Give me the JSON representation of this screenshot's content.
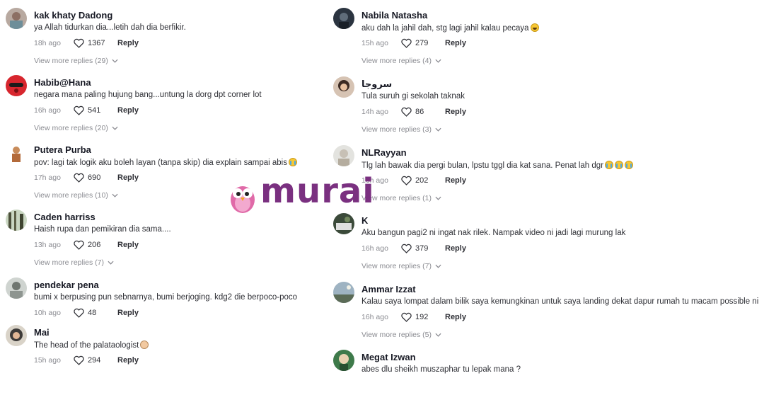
{
  "left_comments": [
    {
      "username": "kak khaty Dadong",
      "text": "ya Allah tidurkan dia...letih dah dia berfikir.",
      "emoji": "",
      "time": "18h ago",
      "likes": "1367",
      "reply": "Reply",
      "more_replies": "View more replies (29)",
      "avatar": "avatar-photo-1"
    },
    {
      "username": "Habib@Hana",
      "text": "negara mana paling hujung bang...untung la dorg dpt corner lot",
      "emoji": "",
      "time": "16h ago",
      "likes": "541",
      "reply": "Reply",
      "more_replies": "View more replies (20)",
      "avatar": "avatar-mask"
    },
    {
      "username": "Putera Purba",
      "text": "pov: lagi tak logik aku boleh layan (tanpa skip) dia explain sampai abis",
      "emoji": "cry",
      "time": "17h ago",
      "likes": "690",
      "reply": "Reply",
      "more_replies": "View more replies (10)",
      "avatar": "avatar-person"
    },
    {
      "username": "Caden harriss",
      "text": "Haish rupa dan pemikiran dia sama....",
      "emoji": "",
      "time": "13h ago",
      "likes": "206",
      "reply": "Reply",
      "more_replies": "View more replies (7)",
      "avatar": "avatar-trees"
    },
    {
      "username": "pendekar pena",
      "text": "bumi x berpusing pun sebnarnya, bumi berjoging. kdg2 die berpoco-poco",
      "emoji": "",
      "time": "10h ago",
      "likes": "48",
      "reply": "Reply",
      "more_replies": "",
      "avatar": "avatar-portrait"
    },
    {
      "username": "Mai",
      "text": "The head of the palataologist",
      "emoji": "person",
      "time": "15h ago",
      "likes": "294",
      "reply": "Reply",
      "more_replies": "",
      "avatar": "avatar-hijab"
    }
  ],
  "right_comments": [
    {
      "username": "Nabila Natasha",
      "text": "aku dah la jahil dah, stg lagi jahil kalau pecaya",
      "emoji": "laugh",
      "time": "15h ago",
      "likes": "279",
      "reply": "Reply",
      "more_replies": "View more replies (4)",
      "avatar": "avatar-dark"
    },
    {
      "username": "سروجا",
      "text": "Tula suruh gi sekolah taknak",
      "emoji": "",
      "time": "14h ago",
      "likes": "86",
      "reply": "Reply",
      "more_replies": "View more replies (3)",
      "avatar": "avatar-woman"
    },
    {
      "username": "NLRayyan",
      "text": "Tlg lah bawak dia pergi bulan, lpstu tggl dia kat sana. Penat lah dgr",
      "emoji": "cry3",
      "time": "16h ago",
      "likes": "202",
      "reply": "Reply",
      "more_replies": "View more replies (1)",
      "avatar": "avatar-light"
    },
    {
      "username": "K",
      "text": "Aku bangun pagi2 ni ingat nak rilek. Nampak video ni jadi lagi murung lak",
      "emoji": "",
      "time": "16h ago",
      "likes": "379",
      "reply": "Reply",
      "more_replies": "View more replies (7)",
      "avatar": "avatar-green"
    },
    {
      "username": "Ammar Izzat",
      "text": "Kalau saya lompat dalam bilik saya kemungkinan untuk saya landing dekat dapur rumah tu macam possible ni",
      "emoji": "",
      "time": "16h ago",
      "likes": "192",
      "reply": "Reply",
      "more_replies": "View more replies (5)",
      "avatar": "avatar-sky"
    },
    {
      "username": "Megat Izwan",
      "text": "abes dlu sheikh muszaphar tu lepak mana ?",
      "emoji": "",
      "time": "",
      "likes": "",
      "reply": "",
      "more_replies": "",
      "avatar": "avatar-cartoon"
    }
  ],
  "watermark": {
    "text": "murai",
    "color": "#7a3080"
  },
  "colors": {
    "meta": "#8a8b91",
    "text": "#161823",
    "brand": "#7a3080"
  }
}
